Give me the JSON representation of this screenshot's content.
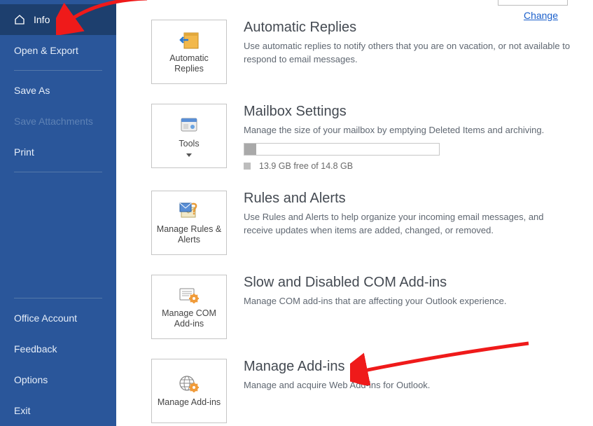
{
  "top": {
    "change_link": "Change"
  },
  "sidebar": {
    "items": [
      {
        "label": "Info",
        "selected": true,
        "icon": "home"
      },
      {
        "label": "Open & Export"
      },
      {
        "label": "Save As"
      },
      {
        "label": "Save Attachments",
        "disabled": true
      },
      {
        "label": "Print"
      }
    ],
    "footer_items": [
      {
        "label": "Office Account"
      },
      {
        "label": "Feedback"
      },
      {
        "label": "Options"
      },
      {
        "label": "Exit"
      }
    ]
  },
  "sections": [
    {
      "tile_label": "Automatic Replies",
      "title": "Automatic Replies",
      "desc": "Use automatic replies to notify others that you are on vacation, or not available to respond to email messages."
    },
    {
      "tile_label": "Tools",
      "tile_dropdown": true,
      "title": "Mailbox Settings",
      "desc": "Manage the size of your mailbox by emptying Deleted Items and archiving.",
      "storage_text": "13.9 GB free of 14.8 GB",
      "storage_pct": 6
    },
    {
      "tile_label": "Manage Rules & Alerts",
      "title": "Rules and Alerts",
      "desc": "Use Rules and Alerts to help organize your incoming email messages, and receive updates when items are added, changed, or removed."
    },
    {
      "tile_label": "Manage COM Add-ins",
      "title": "Slow and Disabled COM Add-ins",
      "desc": "Manage COM add-ins that are affecting your Outlook experience."
    },
    {
      "tile_label": "Manage Add-ins",
      "title": "Manage Add-ins",
      "desc": "Manage and acquire Web Add-ins for Outlook."
    }
  ]
}
